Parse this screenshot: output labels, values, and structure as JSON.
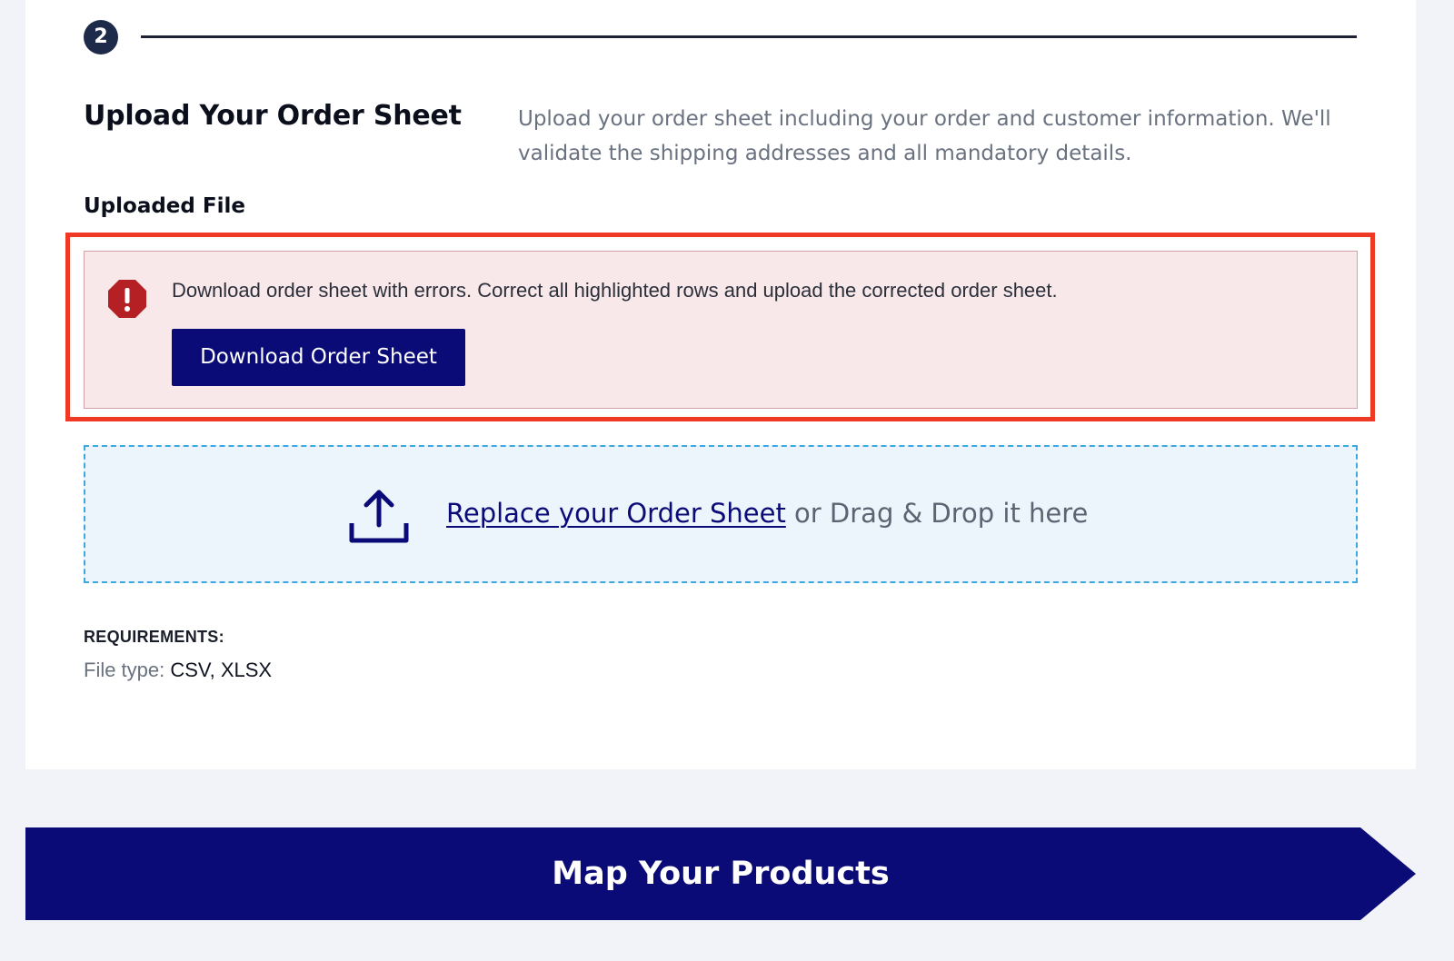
{
  "step": {
    "number": "2"
  },
  "section": {
    "title": "Upload Your Order Sheet",
    "description": "Upload your order sheet including your order and customer information. We'll validate the shipping addresses and all mandatory details."
  },
  "uploaded_file": {
    "label": "Uploaded File"
  },
  "error": {
    "icon": "alert-octagon-icon",
    "message": "Download order sheet with errors. Correct all highlighted rows and upload the corrected order sheet.",
    "button_label": "Download Order Sheet"
  },
  "dropzone": {
    "icon": "upload-icon",
    "link_text": "Replace your Order Sheet",
    "suffix_text": " or Drag & Drop it here"
  },
  "requirements": {
    "label": "REQUIREMENTS:",
    "file_type_label": "File type: ",
    "file_type_value": "CSV, XLSX"
  },
  "next_step": {
    "label": "Map Your Products"
  },
  "colors": {
    "page_background": "#f1f3f8",
    "card_background": "#ffffff",
    "primary_navy": "#0b0b78",
    "error_background": "#f8e8e9",
    "error_icon": "#b52025",
    "highlight_frame": "#ee3a24",
    "dropzone_background": "#ecf5fc",
    "dropzone_border": "#3fa7e0",
    "muted_text": "#6a7280"
  }
}
